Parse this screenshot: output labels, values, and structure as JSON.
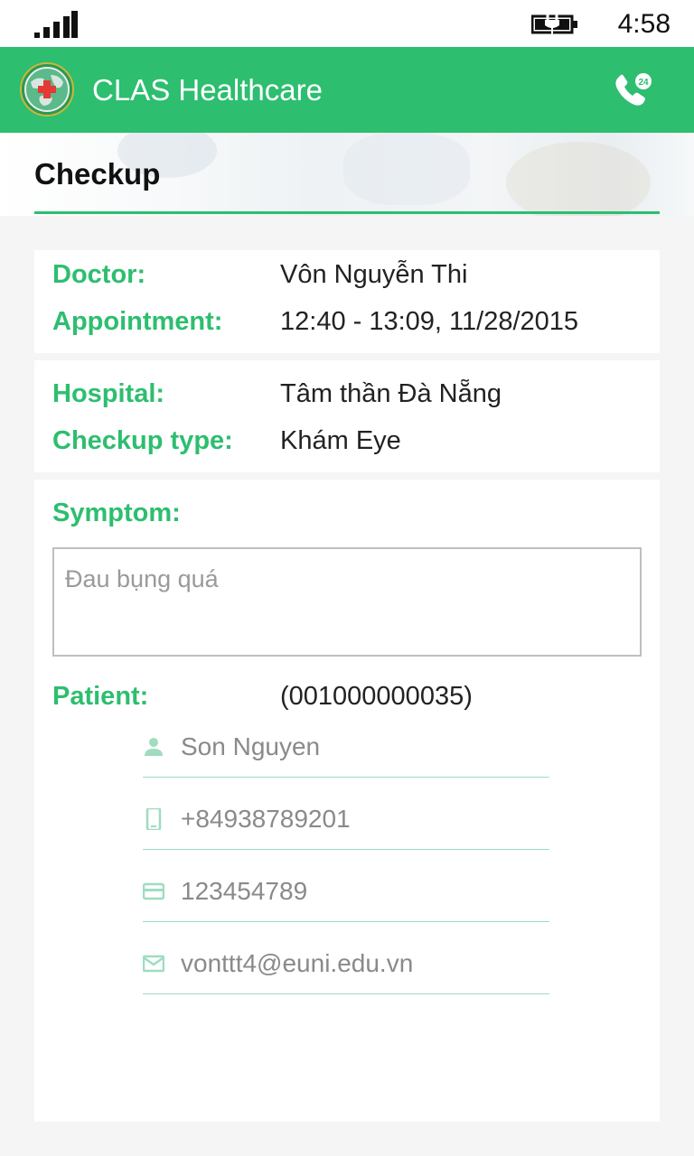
{
  "status_bar": {
    "time": "4:58",
    "icons": [
      "signal-icon",
      "battery-charging-icon"
    ]
  },
  "app_bar": {
    "title": "CLAS Healthcare",
    "logo_icon": "clas-globe-logo",
    "hotline_icon": "phone-24-icon",
    "hotline_badge": "24"
  },
  "header": {
    "title": "Checkup"
  },
  "appointment_card": {
    "doctor_label": "Doctor:",
    "doctor_value": "Vôn Nguyễn Thi",
    "appointment_label": "Appointment:",
    "appointment_value": "12:40 - 13:09, 11/28/2015"
  },
  "hospital_card": {
    "hospital_label": "Hospital:",
    "hospital_value": "Tâm thần Đà Nẵng",
    "checkup_type_label": "Checkup type:",
    "checkup_type_value": "Khám Eye"
  },
  "detail_card": {
    "symptom_label": "Symptom:",
    "symptom_value": "Đau bụng quá",
    "patient_label": "Patient:",
    "patient_id": "(001000000035)",
    "fields": {
      "name": {
        "icon": "person-icon",
        "value": "Son Nguyen"
      },
      "phone": {
        "icon": "phone-icon",
        "value": "+84938789201"
      },
      "card": {
        "icon": "credit-card-icon",
        "value": "123454789"
      },
      "email": {
        "icon": "mail-icon",
        "value": "vonttt4@euni.edu.vn"
      }
    }
  },
  "colors": {
    "accent": "#2dbe6f",
    "field_underline": "#9fdcc0",
    "background": "#f4f5f4"
  }
}
